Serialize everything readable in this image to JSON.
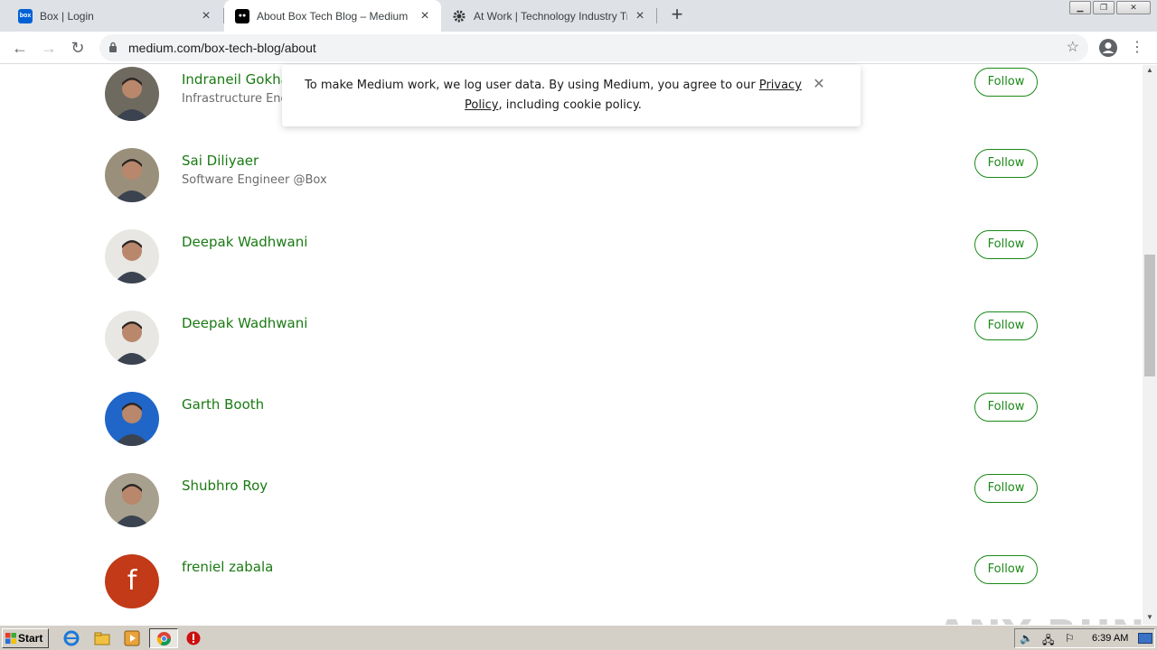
{
  "browser": {
    "tabs": [
      {
        "title": "Box | Login",
        "icon": "box-favicon"
      },
      {
        "title": "About Box Tech Blog – Medium",
        "icon": "medium-favicon"
      },
      {
        "title": "At Work | Technology Industry Trends",
        "icon": "gear-favicon"
      }
    ],
    "url": "medium.com/box-tech-blog/about"
  },
  "cookie_banner": {
    "text_before": "To make Medium work, we log user data. By using Medium, you agree to our ",
    "link_text": "Privacy Policy",
    "text_after": ", including cookie policy."
  },
  "people": [
    {
      "name": "Indraneil Gokha",
      "bio": "Infrastructure Eng",
      "avatar_color": "#6f6a60",
      "follow": "Follow"
    },
    {
      "name": "Sai Diliyaer",
      "bio": "Software Engineer @Box",
      "avatar_color": "#9a8f7a",
      "follow": "Follow"
    },
    {
      "name": "Deepak Wadhwani",
      "bio": "",
      "avatar_color": "#e9e7e4",
      "follow": "Follow"
    },
    {
      "name": "Deepak Wadhwani",
      "bio": "",
      "avatar_color": "#e9e7e4",
      "follow": "Follow"
    },
    {
      "name": "Garth Booth",
      "bio": "",
      "avatar_color": "#1f66c8",
      "follow": "Follow"
    },
    {
      "name": "Shubhro Roy",
      "bio": "",
      "avatar_color": "#a8a08e",
      "follow": "Follow"
    },
    {
      "name": "freniel zabala",
      "bio": "",
      "avatar_color": "#c23a17",
      "avatar_letter": "f",
      "follow": "Follow"
    }
  ],
  "watermark": "ANY RUN",
  "taskbar": {
    "start_label": "Start",
    "clock": "6:39 AM"
  },
  "colors": {
    "accent_green": "#1a8917",
    "name_green": "#1a7a12"
  }
}
